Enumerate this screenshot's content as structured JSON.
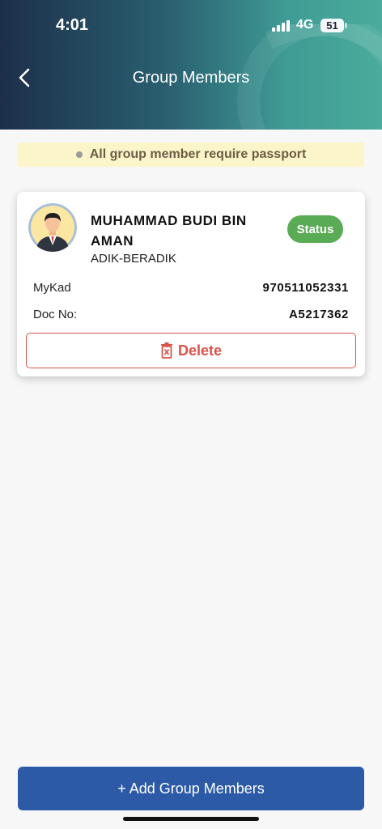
{
  "status_bar": {
    "time": "4:01",
    "network": "4G",
    "battery": "51"
  },
  "header": {
    "title": "Group Members"
  },
  "notice": {
    "text": "All group member require passport"
  },
  "members": [
    {
      "name": "MUHAMMAD BUDI BIN AMAN",
      "relation": "ADIK-BERADIK",
      "status": "Status",
      "mykad_label": "MyKad",
      "mykad_value": "970511052331",
      "doc_label": "Doc No:",
      "doc_value": "A5217362",
      "delete_label": "Delete"
    }
  ],
  "add_button": {
    "label": "+ Add Group Members"
  },
  "colors": {
    "header_start": "#1d2f4a",
    "header_end": "#4aac9c",
    "status_green": "#5aab55",
    "delete_red": "#d9534a",
    "primary_blue": "#2d5aa6",
    "notice_bg": "#fcf5c9"
  },
  "icons": [
    "back-chevron-icon",
    "signal-icon",
    "battery-icon",
    "avatar-icon",
    "trash-icon"
  ]
}
